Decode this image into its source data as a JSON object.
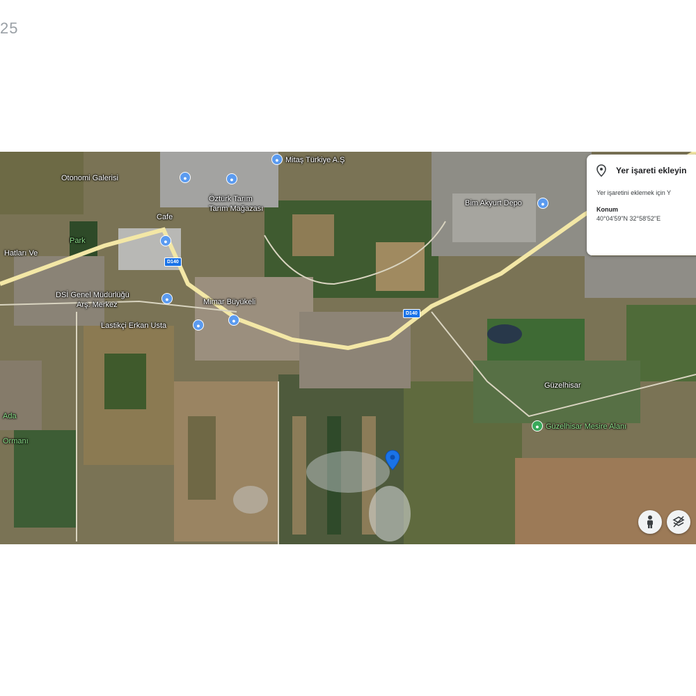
{
  "corner_text": "25",
  "card": {
    "title": "Yer işareti ekleyin",
    "description": "Yer işaretini eklemek için Y",
    "location_label": "Konum",
    "coordinates": "40°04'59\"N 32°58'52\"E"
  },
  "shields": [
    "D140",
    "D140"
  ],
  "labels": {
    "otonomi": "Otonomi Galerisi",
    "mitas": "Mitaş Türkiye A.Ş",
    "cafe": "Cafe",
    "ozturk": "Öztürk Tarım",
    "tarim2": "Tarım Mağazası",
    "bim": "Bim Akyurt Depo",
    "kan": "Kan",
    "hatlari": "Hatları Ve",
    "park": "Park",
    "dsi1": "DSİ Genel Müdürlüğü",
    "dsi2": "Arş. Merkez",
    "lastik": "Lastikçi Erkan Usta",
    "mimar": "Mimar Büyükeli",
    "guzelhisar": "Güzelhisar",
    "mesire": "Güzelhisar Mesire Alanı",
    "ormani": "Ormanı",
    "ada": "Ada"
  },
  "icons": {
    "poi": "map-poi-icon",
    "place_pin": "location-pin-icon",
    "marker": "dropped-pin-icon",
    "pegman": "street-view-pegman-icon",
    "layers": "layers-off-icon"
  },
  "colors": {
    "accent": "#1a73e8",
    "road": "#f3e7a6"
  }
}
